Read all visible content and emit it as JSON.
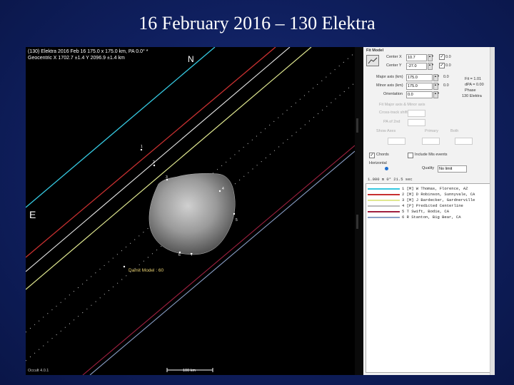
{
  "slide_title": "16 February 2016 – 130 Elektra",
  "plot": {
    "header_line1": "(130) Elektra  2016 Feb 16   175.0 x 175.0 km,  PA 0.0° *",
    "header_line2": "Geocentric  X  1702.7 ±1.4  Y 2096.9 ±1.4 km",
    "north_label": "N",
    "east_label": "E",
    "model_label": "Damit Model : 60",
    "footer_left": "Occult 4.0.1",
    "scale_label": "100 km",
    "chord_tags": [
      "1",
      "2",
      "3",
      "4",
      "5",
      "6",
      "7"
    ]
  },
  "side": {
    "title": "Fit Model",
    "center_x_label": "Center X",
    "center_x_value": "10.7",
    "center_y_label": "Center Y",
    "center_y_value": "-27.0",
    "major_label": "Major axis (km)",
    "major_value": "175.0",
    "minor_label": "Minor axis (km)",
    "minor_value": "175.0",
    "orient_label": "Orientation",
    "orient_value": "0.0",
    "zero_val_1": "0.0",
    "zero_val_2": "0.0",
    "zero_val_3": "0.0",
    "zero_val_4": "0.0",
    "right_info_1": "Fit = 1.01",
    "right_info_2": "dPA = 0.00",
    "right_info_3": "Phase",
    "right_info_4": "130 Elektra",
    "check_label_1": "Fit Major axis & Minor axis",
    "check_label_2": "Cross-track shift",
    "check_label_3": "PA of 2nd",
    "radio_label": "Show Axes",
    "radio_opt_1": "Primary",
    "radio_opt_2": "Both",
    "opt_a": "Chords",
    "opt_b": "Include Mis events",
    "horizontal_label": "Horizontal",
    "quality_label": "Quality",
    "quality_value": "No limit",
    "list_header": "1.000 m  0°  21.5 sec",
    "observers": [
      {
        "text": "1 [M]  W Thomas, Florence, AZ"
      },
      {
        "text": "2 [M]  D Robinson, Sunnyvale, CA"
      },
      {
        "text": "3 [M]  J Bardecker, Gardnerville"
      },
      {
        "text": "4 [P]  Predicted Centerline"
      },
      {
        "text": "5     T Swift, Bodie, CA"
      },
      {
        "text": "6     R Stanton, Big Bear, CA"
      }
    ],
    "colors": {
      "cyan": "#35c8e0",
      "red": "#c83030",
      "yellow_green": "#e0e890",
      "white": "#e8e8e8",
      "maroon": "#a02040",
      "gray_blue": "#8aa0c8"
    }
  }
}
